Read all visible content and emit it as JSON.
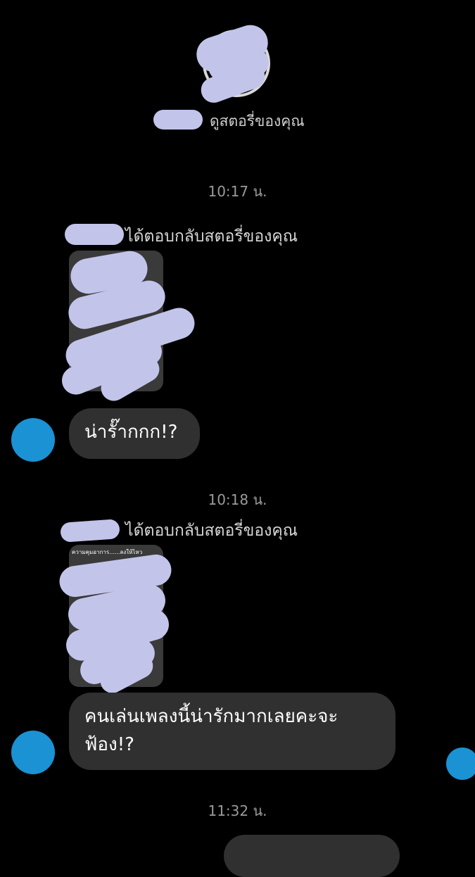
{
  "profile": {
    "viewed_story_text": "ดูสตอรี่ของคุณ"
  },
  "messages": [
    {
      "timestamp": "10:17 น.",
      "reply_label": "ได้ตอบกลับสตอรี่ของคุณ",
      "story_caption": "",
      "text": "น่ารั๊ากกก!?"
    },
    {
      "timestamp": "10:18 น.",
      "reply_label": "ได้ตอบกลับสตอรี่ของคุณ",
      "story_caption": "ความคุมอาการ......ลงให้ไหว",
      "text": "คนเล่นเพลงนี้น่ารักมากเลยคะจะฟ้อง!?"
    }
  ],
  "last_timestamp": "11:32 น.",
  "colors": {
    "background": "#000000",
    "bubble_incoming": "#303030",
    "avatar": "#1a92d4",
    "redaction": "#c3c4ea"
  }
}
